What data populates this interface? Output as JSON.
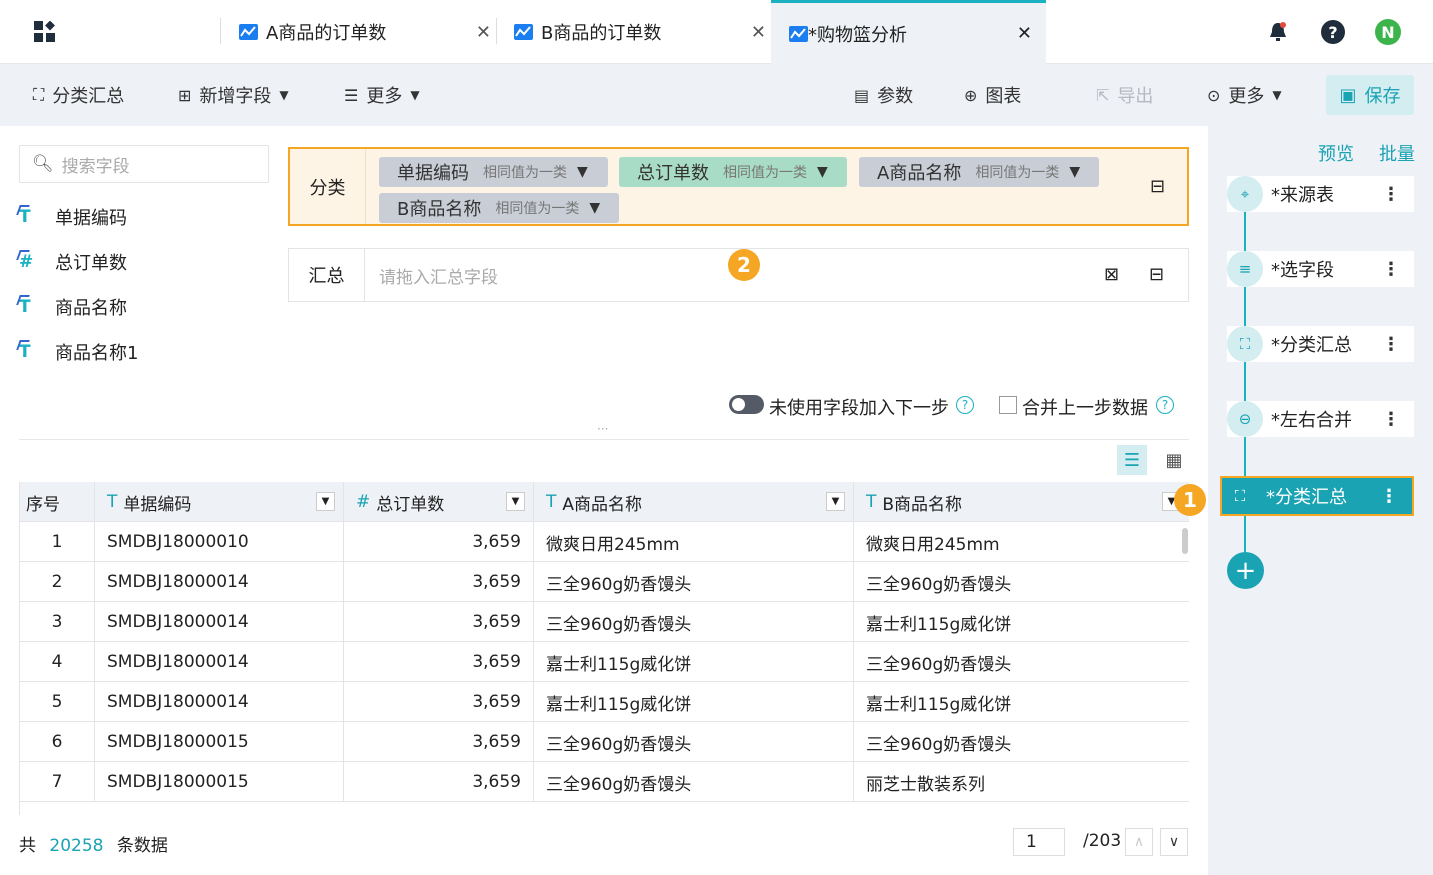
{
  "tabs": [
    {
      "label": "A商品的订单数"
    },
    {
      "label": "B商品的订单数"
    },
    {
      "label": "*购物篮分析"
    }
  ],
  "header_icons": {
    "bell": "bell-icon",
    "help": "?",
    "avatar": "N"
  },
  "toolbar": {
    "group": "分类汇总",
    "add_field": "新增字段",
    "more_left": "更多",
    "params": "参数",
    "chart": "图表",
    "export": "导出",
    "more_right": "更多",
    "save": "保存"
  },
  "search": {
    "placeholder": "搜索字段"
  },
  "fields": [
    "单据编码",
    "总订单数",
    "商品名称",
    "商品名称1"
  ],
  "category": {
    "label": "分类",
    "chips": [
      {
        "name": "单据编码",
        "sub": "相同值为一类"
      },
      {
        "name": "总订单数",
        "sub": "相同值为一类"
      },
      {
        "name": "A商品名称",
        "sub": "相同值为一类"
      },
      {
        "name": "B商品名称",
        "sub": "相同值为一类"
      }
    ]
  },
  "summary": {
    "label": "汇总",
    "placeholder": "请拖入汇总字段"
  },
  "badges": {
    "one": "1",
    "two": "2"
  },
  "options": {
    "unused": "未使用字段加入下一步",
    "merge": "合并上一步数据"
  },
  "table": {
    "headers": [
      "序号",
      "单据编码",
      "总订单数",
      "A商品名称",
      "B商品名称"
    ],
    "rows": [
      [
        "1",
        "SMDBJ18000010",
        "3,659",
        "微爽日用245mm",
        "微爽日用245mm"
      ],
      [
        "2",
        "SMDBJ18000014",
        "3,659",
        "三全960g奶香馒头",
        "三全960g奶香馒头"
      ],
      [
        "3",
        "SMDBJ18000014",
        "3,659",
        "三全960g奶香馒头",
        "嘉士利115g威化饼"
      ],
      [
        "4",
        "SMDBJ18000014",
        "3,659",
        "嘉士利115g威化饼",
        "三全960g奶香馒头"
      ],
      [
        "5",
        "SMDBJ18000014",
        "3,659",
        "嘉士利115g威化饼",
        "嘉士利115g威化饼"
      ],
      [
        "6",
        "SMDBJ18000015",
        "3,659",
        "三全960g奶香馒头",
        "三全960g奶香馒头"
      ],
      [
        "7",
        "SMDBJ18000015",
        "3,659",
        "三全960g奶香馒头",
        "丽芝士散装系列"
      ]
    ]
  },
  "footer": {
    "prefix": "共",
    "count": "20258",
    "suffix": "条数据",
    "page": "1",
    "total": "/203"
  },
  "right": {
    "preview": "预览",
    "batch": "批量",
    "nodes": [
      "*来源表",
      "*选字段",
      "*分类汇总",
      "*左右合并",
      "*分类汇总"
    ]
  },
  "colors": {
    "accent": "#1ab1c1",
    "highlight": "#f5a623"
  }
}
